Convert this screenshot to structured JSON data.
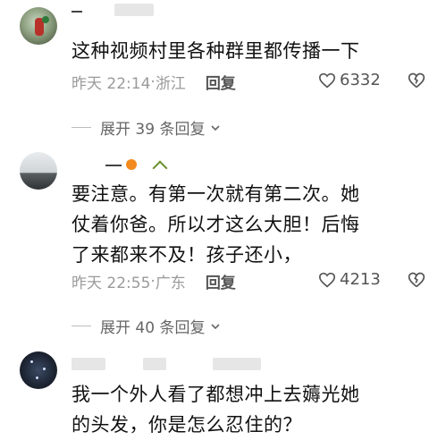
{
  "comments": [
    {
      "text": "这种视频村里各种群里都传播一下",
      "time": "昨天 22:14",
      "location": "浙江",
      "reply_label": "回复",
      "likes": "6332",
      "expand_label": "展开 39 条回复"
    },
    {
      "text": "要注意。有第一次就有第二次。她\n仗着你爸。所以才这么大胆！后悔\n了来都来不及！孩子还小，",
      "time": "昨天 22:55",
      "location": "广东",
      "reply_label": "回复",
      "likes": "4213",
      "expand_label": "展开 40 条回复"
    },
    {
      "text": "我一个外人看了都想冲上去薅光她\n的头发，你是怎么忍住的？"
    }
  ]
}
